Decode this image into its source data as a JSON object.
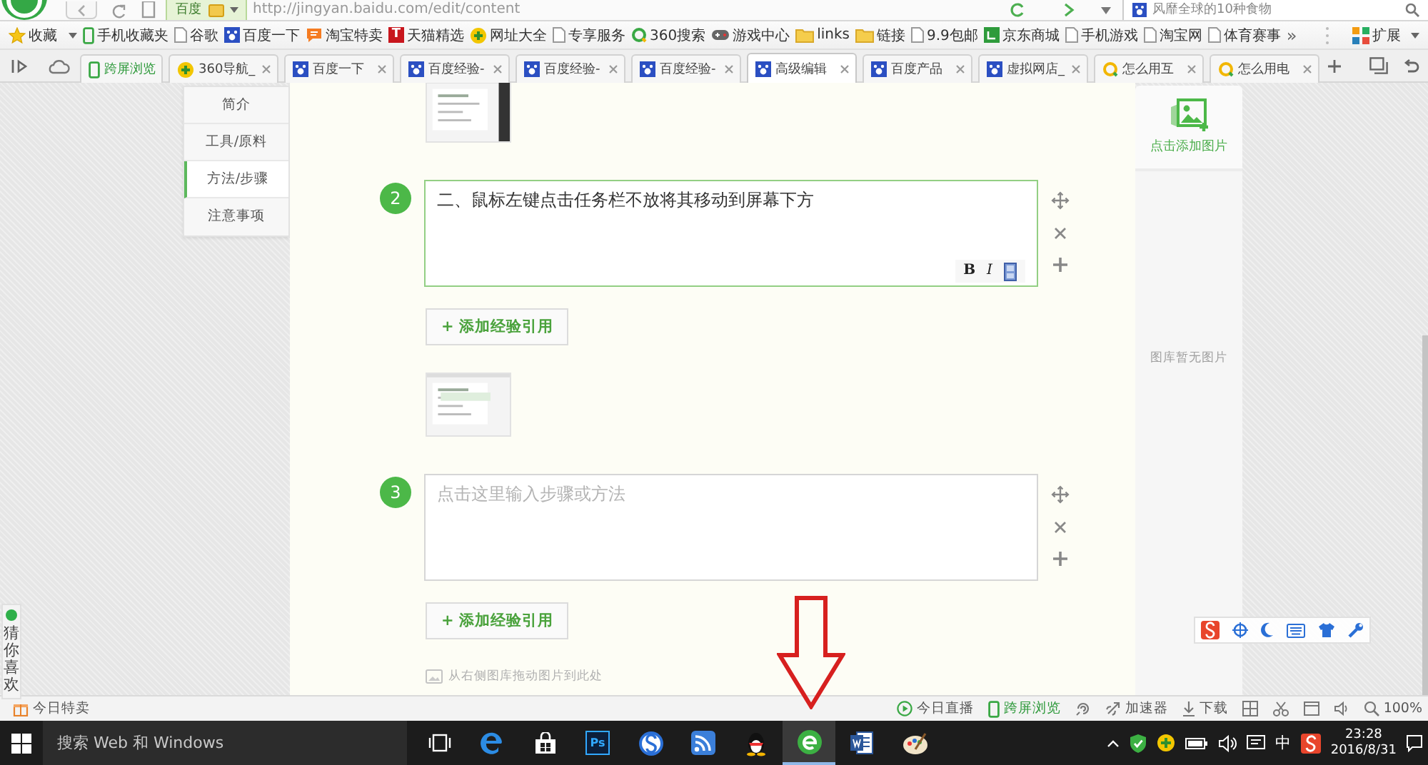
{
  "address_bar": {
    "engine": "百度",
    "url": "http://jingyan.baidu.com/edit/content",
    "search": "风靡全球的10种食物"
  },
  "bookmarks": {
    "items": [
      {
        "kind": "star",
        "label": "收藏",
        "menu": true
      },
      {
        "kind": "phone",
        "label": "手机收藏夹",
        "menu": false
      },
      {
        "kind": "page",
        "label": "谷歌",
        "menu": false
      },
      {
        "kind": "paw",
        "label": "百度一下",
        "menu": false
      },
      {
        "kind": "taobao",
        "label": "淘宝特卖",
        "menu": false
      },
      {
        "kind": "tmall",
        "label": "天猫精选",
        "glyph": "T",
        "menu": false
      },
      {
        "kind": "plus",
        "label": "网址大全",
        "menu": false
      },
      {
        "kind": "page",
        "label": "专享服务",
        "menu": false
      },
      {
        "kind": "ring",
        "label": "360搜索",
        "menu": false
      },
      {
        "kind": "game",
        "label": "游戏中心",
        "menu": false
      },
      {
        "kind": "folder",
        "label": "links",
        "menu": false
      },
      {
        "kind": "folder",
        "label": "链接",
        "menu": false
      },
      {
        "kind": "page",
        "label": "9.9包邮",
        "menu": false
      },
      {
        "kind": "jd",
        "label": "京东商城",
        "menu": false
      },
      {
        "kind": "page",
        "label": "手机游戏",
        "menu": false
      },
      {
        "kind": "page",
        "label": "淘宝网",
        "menu": false
      },
      {
        "kind": "page",
        "label": "体育赛事",
        "menu": false
      }
    ],
    "more": "»",
    "extensions": "扩展"
  },
  "tabs": [
    {
      "kind": "phone",
      "label": "跨屏浏览",
      "selected": false,
      "closable": false
    },
    {
      "kind": "plus",
      "label": "360导航_",
      "selected": false,
      "closable": true
    },
    {
      "kind": "paw",
      "label": "百度一下",
      "selected": false,
      "closable": true
    },
    {
      "kind": "paw",
      "label": "百度经验-",
      "selected": false,
      "closable": true
    },
    {
      "kind": "paw",
      "label": "百度经验-",
      "selected": false,
      "closable": true
    },
    {
      "kind": "paw",
      "label": "百度经验-",
      "selected": false,
      "closable": true
    },
    {
      "kind": "paw",
      "label": "高级编辑",
      "selected": true,
      "closable": true
    },
    {
      "kind": "paw",
      "label": "百度产品",
      "selected": false,
      "closable": true
    },
    {
      "kind": "paw",
      "label": "虚拟网店_",
      "selected": false,
      "closable": true
    },
    {
      "kind": "ring",
      "label": "怎么用互",
      "selected": false,
      "closable": true
    },
    {
      "kind": "ring",
      "label": "怎么用电",
      "selected": false,
      "closable": true
    }
  ],
  "side_nav": [
    {
      "label": "简介",
      "selected": false
    },
    {
      "label": "工具/原料",
      "selected": false
    },
    {
      "label": "方法/步骤",
      "selected": true
    },
    {
      "label": "注意事项",
      "selected": false
    }
  ],
  "editor": {
    "blocks": [
      {
        "kind": "thumbnail"
      },
      {
        "kind": "step",
        "number": "2",
        "value": "二、鼠标左键点击任务栏不放将其移动到屏幕下方",
        "focused": true
      },
      {
        "kind": "cite",
        "label": "+ 添加经验引用"
      },
      {
        "kind": "thumbnail"
      },
      {
        "kind": "step",
        "number": "3",
        "placeholder": "点击这里输入步骤或方法",
        "focused": false
      },
      {
        "kind": "cite",
        "label": "+ 添加经验引用"
      },
      {
        "kind": "drop_hint",
        "label": "从右侧图库拖动图片到此处"
      }
    ],
    "format_buttons": [
      "B",
      "I"
    ]
  },
  "gallery": {
    "upload_label": "点击添加图片",
    "empty_text": "图库暂无图片"
  },
  "recommend": {
    "label": "猜你喜欢"
  },
  "status_bar": {
    "left": "今日特卖",
    "items": [
      {
        "kind": "live",
        "label": "今日直播"
      },
      {
        "kind": "crossscreen",
        "label": "跨屏浏览"
      },
      {
        "kind": "swirl"
      },
      {
        "kind": "accelerator",
        "label": "加速器"
      },
      {
        "kind": "download",
        "label": "下载"
      },
      {
        "kind": "grid"
      },
      {
        "kind": "capture"
      },
      {
        "kind": "window"
      },
      {
        "kind": "sound"
      },
      {
        "kind": "zoom",
        "label": "100%"
      }
    ]
  },
  "taskbar": {
    "search": {
      "placeholder": "搜索 Web 和 Windows"
    },
    "apps": [
      {
        "kind": "taskview",
        "active": false
      },
      {
        "kind": "edge",
        "active": false
      },
      {
        "kind": "store",
        "active": false
      },
      {
        "kind": "photoshop",
        "label": "Ps",
        "active": false
      },
      {
        "kind": "sogou",
        "active": false
      },
      {
        "kind": "feed",
        "active": false
      },
      {
        "kind": "qq",
        "active": false
      },
      {
        "kind": "browser360",
        "active": true
      },
      {
        "kind": "word",
        "active": false
      },
      {
        "kind": "paint",
        "active": false
      }
    ],
    "tray": {
      "ime": "中",
      "time": "23:28",
      "date": "2016/8/31"
    }
  }
}
